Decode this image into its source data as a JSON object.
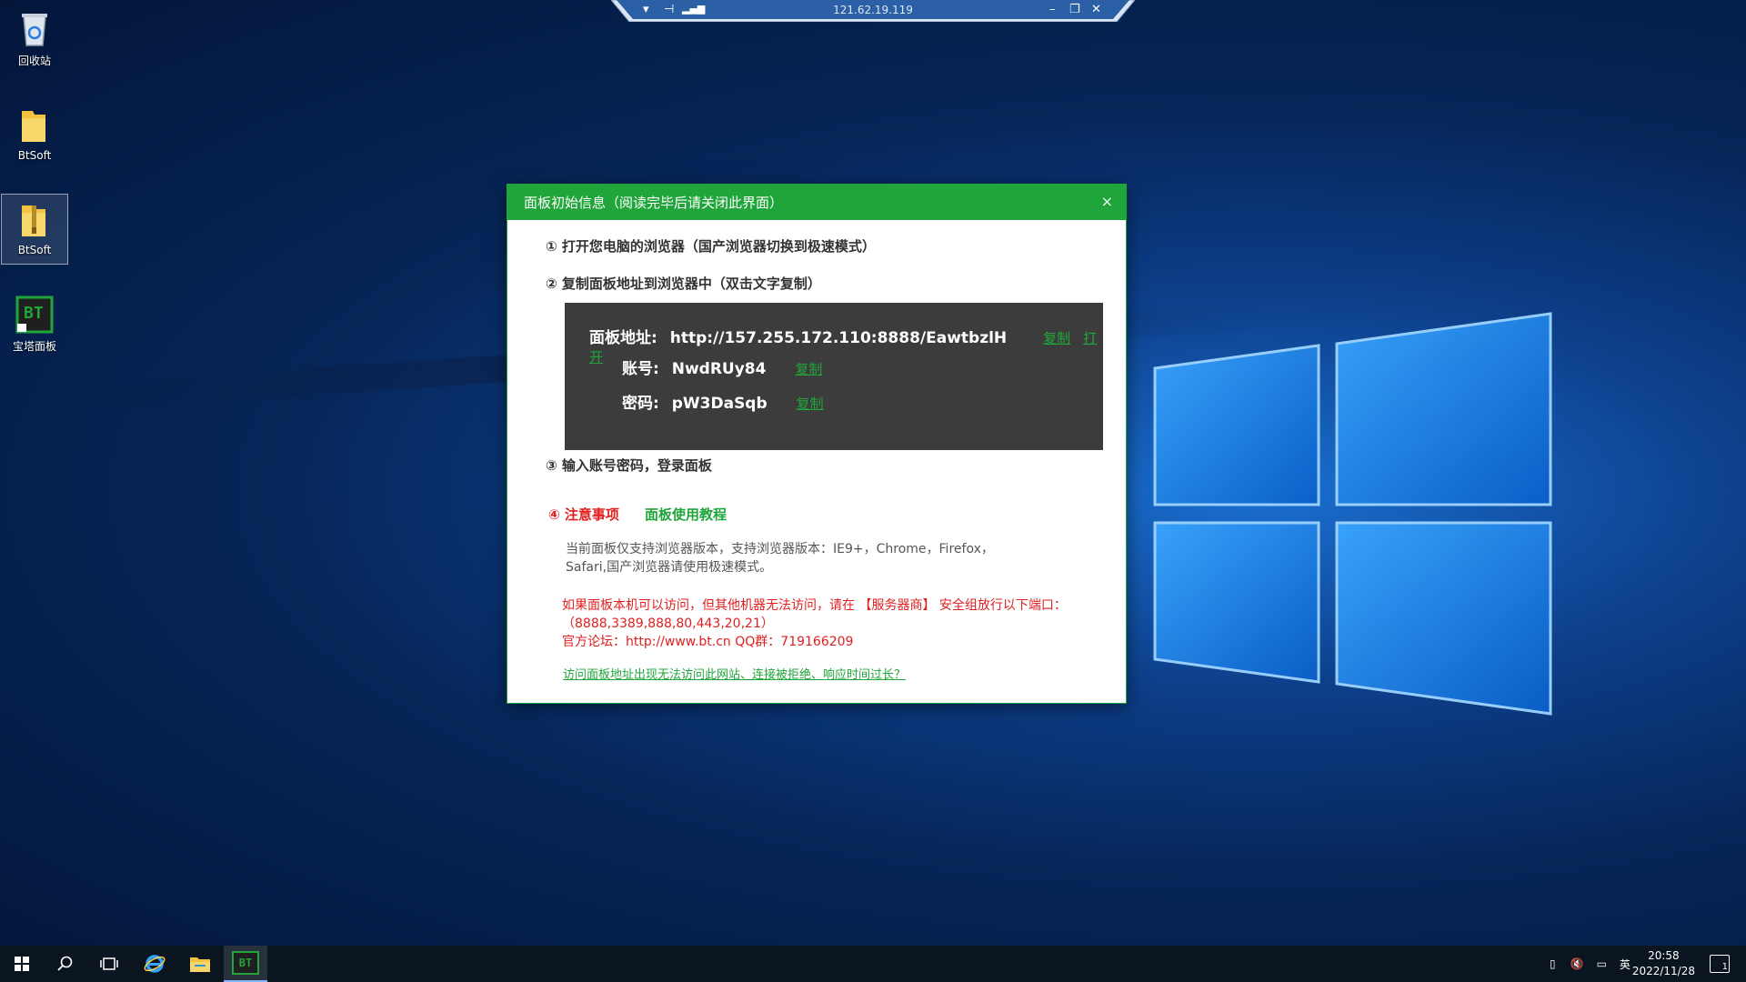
{
  "remote_bar": {
    "ip": "121.62.19.119"
  },
  "desktop_icons": [
    {
      "label": "回收站",
      "icon": "recycle-bin-icon"
    },
    {
      "label": "BtSoft",
      "icon": "folder-icon"
    },
    {
      "label": "BtSoft",
      "icon": "zip-folder-icon"
    },
    {
      "label": "宝塔面板",
      "icon": "bt-panel-icon",
      "badge": "BT"
    }
  ],
  "dialog": {
    "title": "面板初始信息（阅读完毕后请关闭此界面）",
    "close": "×",
    "step1": "① 打开您电脑的浏览器（国产浏览器切换到极速模式）",
    "step2": "② 复制面板地址到浏览器中（双击文字复制）",
    "address_label": "面板地址:",
    "address_value": "http://157.255.172.110:8888/EawtbzlH",
    "username_label": "账号:",
    "username_value": "NwdRUy84",
    "password_label": "密码:",
    "password_value": "pW3DaSqb",
    "copy_label": "复制",
    "open_label": "打开",
    "step3": "③ 输入账号密码，登录面板",
    "note_title": "④ 注意事项",
    "tutorial_link": "面板使用教程",
    "browser_note_line1": "当前面板仅支持浏览器版本，支持浏览器版本：IE9+，Chrome，Firefox，",
    "browser_note_line2": "Safari,国产浏览器请使用极速模式。",
    "red_note_line1": "如果面板本机可以访问，但其他机器无法访问，请在 【服务器商】 安全组放行以下端口：",
    "red_note_line2": "（8888,3389,888,80,443,20,21）",
    "red_note_line3": "官方论坛：http://www.bt.cn  QQ群：719166209",
    "bottom_link": "访问面板地址出现无法访问此网站、连接被拒绝、响应时间过长？"
  },
  "taskbar": {
    "active_app_label": "BT",
    "tray_language": "英",
    "clock_time": "20:58",
    "clock_date": "2022/11/28",
    "notification_count": "1"
  }
}
